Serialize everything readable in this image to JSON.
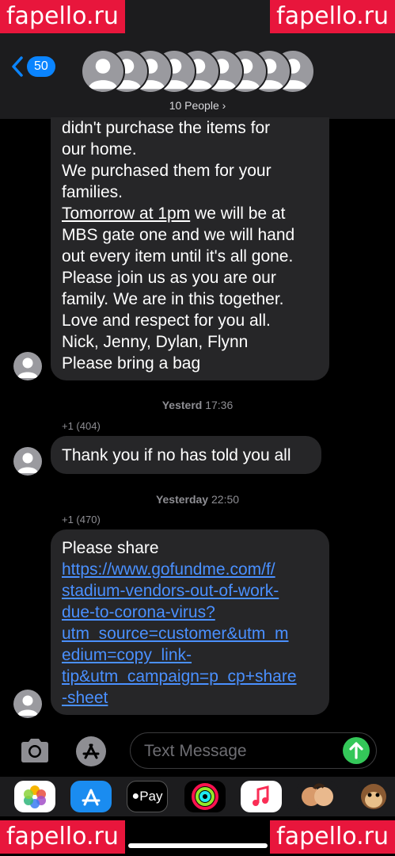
{
  "watermarks": {
    "text": "fapello.ru"
  },
  "header": {
    "back_badge": "50",
    "people_label": "10 People ›"
  },
  "messages": {
    "first": {
      "lines": [
        "didn't purchase the items for",
        "our home.",
        "We purchased them for your",
        "families.",
        "Tomorrow at 1pm",
        " we will be at",
        "MBS gate one and we will hand",
        "out every item until it's all gone.",
        "Please join us as you are our",
        "family. We are in this together.",
        "Love and respect for you all.",
        "Nick, Jenny, Dylan, Flynn",
        "Please bring a bag"
      ]
    },
    "ts1": {
      "day": "Yesterd",
      "time": "17:36"
    },
    "sender1": "+1 (404)",
    "second": {
      "text": "Thank you if no has told you all"
    },
    "ts2": {
      "day": "Yesterday",
      "time": "22:50"
    },
    "sender2": "+1 (470)",
    "third": {
      "intro": "Please share",
      "link_lines": [
        "https://www.gofundme.com/f/",
        "stadium-vendors-out-of-work-",
        "due-to-corona-virus?",
        "utm_source=customer&utm_m",
        "edium=copy_link-",
        "tip&utm_campaign=p_cp+share",
        "-sheet"
      ]
    }
  },
  "input": {
    "placeholder": "Text Message"
  },
  "app_strip": {
    "apple_pay": "Pay",
    "icons": [
      "photos-icon",
      "app-store-icon",
      "apple-pay-icon",
      "activity-icon",
      "music-icon",
      "memoji-icon",
      "animoji-monkey-icon"
    ]
  },
  "colors": {
    "accent": "#0a84ff",
    "send": "#34c759",
    "bubble": "#262628",
    "link": "#4a90ff",
    "watermark": "#e8163c"
  }
}
